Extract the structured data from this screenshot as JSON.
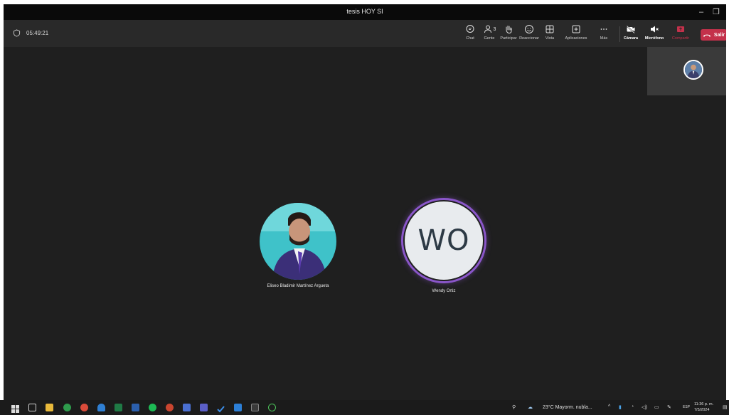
{
  "window": {
    "title": "tesis HOY SI"
  },
  "toolbar": {
    "timer": "05:49:21",
    "chat_label": "Chat",
    "people_label": "Gente",
    "people_count": "3",
    "raise_label": "Participar",
    "react_label": "Reaccionar",
    "view_label": "Vista",
    "apps_label": "Aplicaciones",
    "more_label": "Más",
    "camera_label": "Cámara",
    "mic_label": "Micrófono",
    "share_label": "Compartir",
    "leave_label": "Salir"
  },
  "participants": [
    {
      "name": "Eliseo Bladimir Martínez Argueta"
    },
    {
      "name": "Wendy Ortiz",
      "initials": "WO"
    }
  ],
  "taskbar": {
    "weather": "23°C  Mayorm. nubla...",
    "language": "ESP",
    "time": "11:36 p. m.",
    "date": "7/5/2024"
  },
  "colors": {
    "leave": "#c4314b",
    "ring": "#8a56c9",
    "stage": "#1f1f1f"
  }
}
